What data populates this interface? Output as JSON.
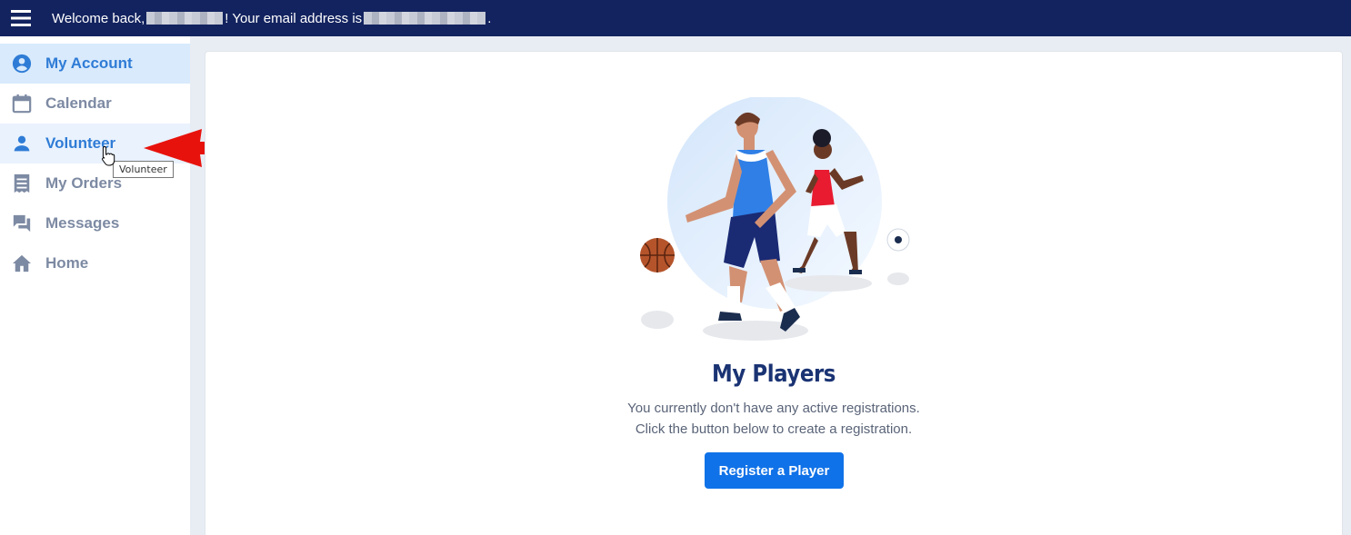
{
  "header": {
    "welcome_prefix": "Welcome back,",
    "email_prefix": "! Your email address is",
    "email_suffix": "."
  },
  "sidebar": {
    "items": [
      {
        "label": "My Account",
        "icon": "account-circle-icon",
        "state": "active"
      },
      {
        "label": "Calendar",
        "icon": "calendar-icon",
        "state": "normal"
      },
      {
        "label": "Volunteer",
        "icon": "person-icon",
        "state": "hover"
      },
      {
        "label": "My Orders",
        "icon": "receipt-icon",
        "state": "normal"
      },
      {
        "label": "Messages",
        "icon": "chat-icon",
        "state": "normal"
      },
      {
        "label": "Home",
        "icon": "home-icon",
        "state": "normal"
      }
    ]
  },
  "tooltip": {
    "text": "Volunteer"
  },
  "main": {
    "title": "My Players",
    "line1": "You currently don't have any active registrations.",
    "line2": "Click the button below to create a registration.",
    "button_label": "Register a Player"
  },
  "colors": {
    "topbar": "#13235f",
    "accent": "#1072e8",
    "active_bg": "#d8eafc",
    "arrow": "#e8120c"
  }
}
